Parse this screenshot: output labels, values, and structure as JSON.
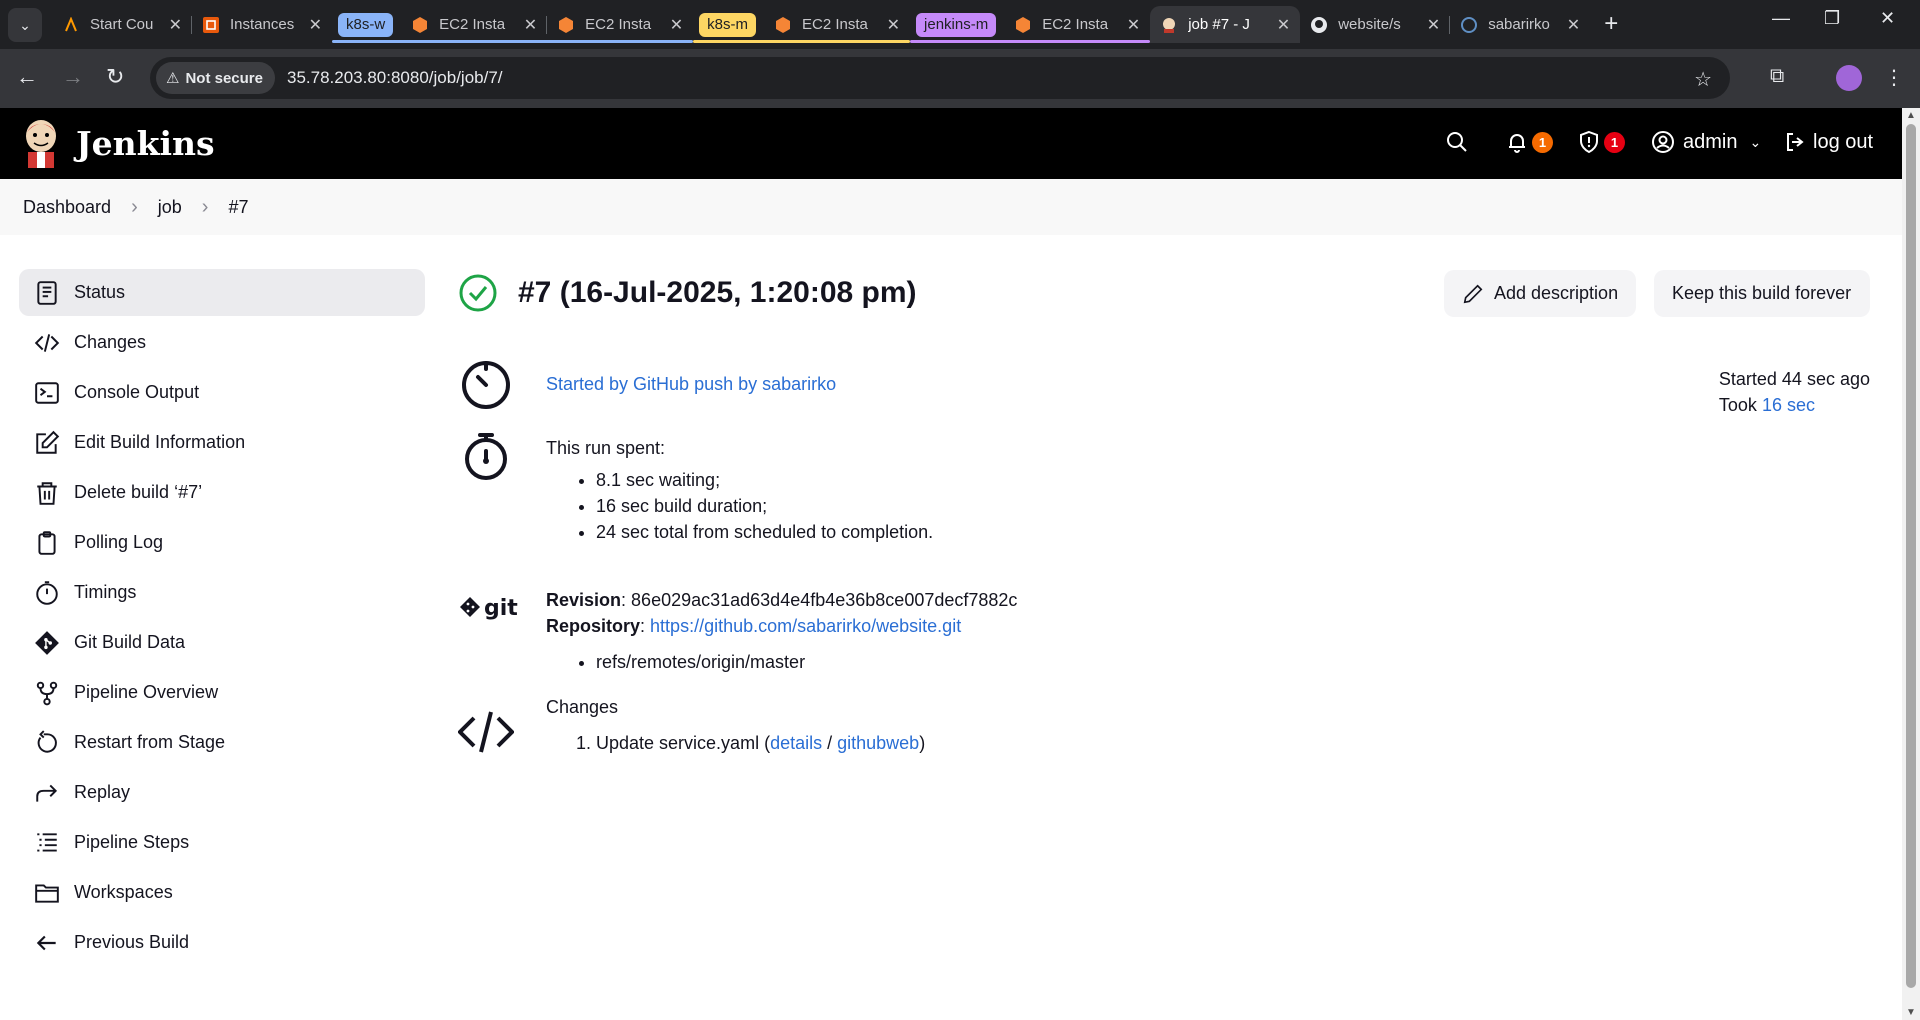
{
  "browser": {
    "tabs": [
      {
        "title": "Start Cou",
        "icon": "aws-icon",
        "group": null
      },
      {
        "title": "Instances",
        "icon": "instances-icon",
        "group": null
      },
      {
        "title": "EC2 Insta",
        "icon": "ec2-icon",
        "group": "k8s-w"
      },
      {
        "title": "EC2 Insta",
        "icon": "ec2-icon",
        "group": "k8s-w"
      },
      {
        "title": "EC2 Insta",
        "icon": "ec2-icon",
        "group": "k8s-m"
      },
      {
        "title": "EC2 Insta",
        "icon": "ec2-icon",
        "group": "jenkins-m"
      },
      {
        "title": "job #7 - J",
        "icon": "jenkins-icon",
        "group": null,
        "active": true
      },
      {
        "title": "website/s",
        "icon": "github-icon",
        "group": null
      },
      {
        "title": "sabarirko",
        "icon": "globe-icon",
        "group": null
      }
    ],
    "groups": [
      {
        "label": "k8s-w",
        "color": "#8ab4f8"
      },
      {
        "label": "k8s-m",
        "color": "#fdd663"
      },
      {
        "label": "jenkins-m",
        "color": "#c58af9"
      }
    ],
    "security_label": "Not secure",
    "url": "35.78.203.80:8080/job/job/7/"
  },
  "jenkins": {
    "brand": "Jenkins",
    "notifications_count": "1",
    "security_count": "1",
    "user": "admin",
    "logout": "log out"
  },
  "breadcrumb": [
    "Dashboard",
    "job",
    "#7"
  ],
  "sidebar": [
    {
      "label": "Status",
      "icon": "status-icon",
      "active": true
    },
    {
      "label": "Changes",
      "icon": "code-icon"
    },
    {
      "label": "Console Output",
      "icon": "terminal-icon"
    },
    {
      "label": "Edit Build Information",
      "icon": "edit-icon"
    },
    {
      "label": "Delete build ‘#7’",
      "icon": "trash-icon"
    },
    {
      "label": "Polling Log",
      "icon": "clipboard-icon"
    },
    {
      "label": "Timings",
      "icon": "stopwatch-icon"
    },
    {
      "label": "Git Build Data",
      "icon": "git-icon"
    },
    {
      "label": "Pipeline Overview",
      "icon": "branch-icon"
    },
    {
      "label": "Restart from Stage",
      "icon": "restart-icon"
    },
    {
      "label": "Replay",
      "icon": "replay-icon"
    },
    {
      "label": "Pipeline Steps",
      "icon": "list-icon"
    },
    {
      "label": "Workspaces",
      "icon": "folder-icon"
    },
    {
      "label": "Previous Build",
      "icon": "arrow-left-icon"
    }
  ],
  "build": {
    "title": "#7 (16-Jul-2025, 1:20:08 pm)",
    "add_description": "Add description",
    "keep_forever": "Keep this build forever",
    "cause": "Started by GitHub push by sabarirko",
    "started_label": "Started 44 sec ago",
    "took_label": "Took",
    "took_value": "16 sec",
    "run_spent_label": "This run spent:",
    "run_spent": [
      "8.1 sec waiting;",
      "16 sec build duration;",
      "24 sec total from scheduled to completion."
    ],
    "revision_label": "Revision",
    "revision": "86e029ac31ad63d4e4fb4e36b8ce007decf7882c",
    "repository_label": "Repository",
    "repository": "https://github.com/sabarirko/website.git",
    "branches": [
      "refs/remotes/origin/master"
    ],
    "changes_label": "Changes",
    "changes": [
      {
        "message": "Update service.yaml",
        "details": "details",
        "web": "githubweb"
      }
    ]
  },
  "colors": {
    "success": "#1ea446",
    "link": "#2a6ed4",
    "notif_badge": "#f56a00",
    "security_badge": "#e60012"
  }
}
